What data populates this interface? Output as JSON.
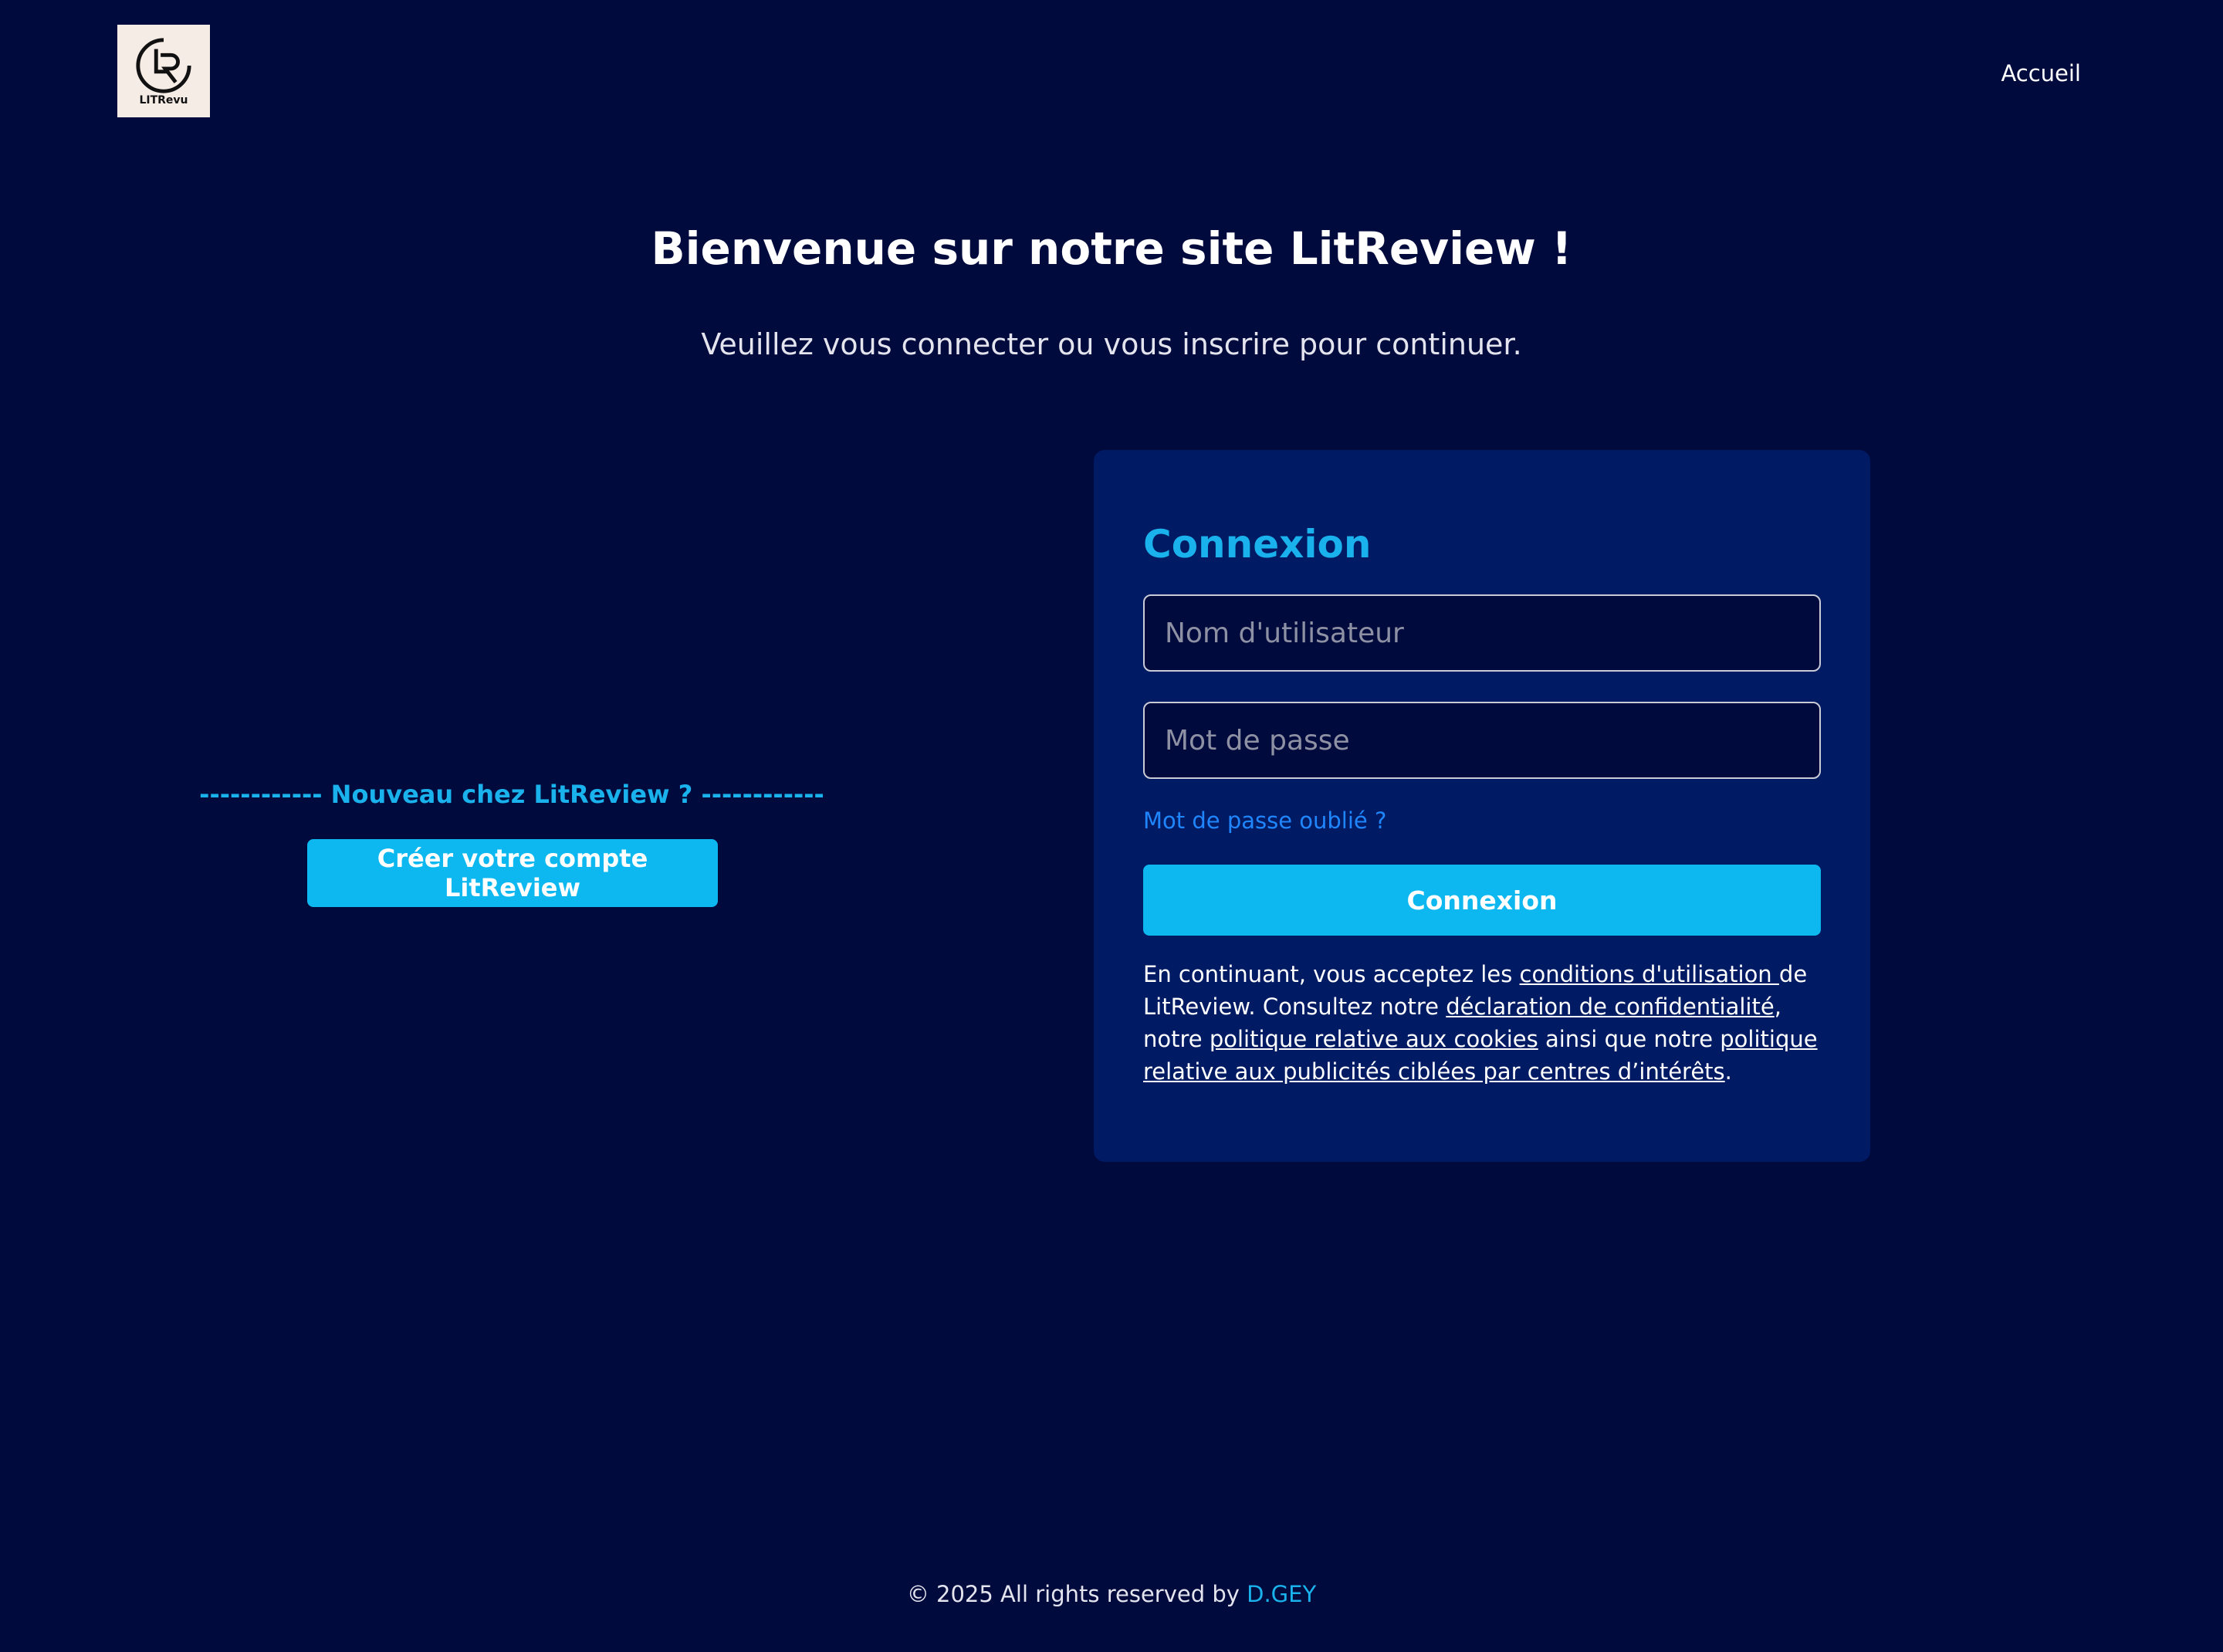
{
  "header": {
    "logo_text": "LITRevu",
    "nav_home": "Accueil"
  },
  "hero": {
    "title": "Bienvenue sur notre site LitReview !",
    "subtitle": "Veuillez vous connecter ou vous inscrire pour continuer."
  },
  "signup": {
    "heading": "------------ Nouveau chez LitReview ? ------------",
    "button_label": "Créer votre compte LitReview"
  },
  "login": {
    "title": "Connexion",
    "username_placeholder": "Nom d'utilisateur",
    "username_value": "",
    "password_placeholder": "Mot de passe",
    "password_value": "",
    "forgot_password": "Mot de passe oublié ?",
    "submit_label": "Connexion",
    "legal": {
      "part1": "En continuant, vous acceptez les ",
      "terms_link": "conditions d'utilisation ",
      "part2": "de LitReview. Consultez notre ",
      "privacy_link": "déclaration de confidentialité",
      "part3": ", notre ",
      "cookies_link": "politique relative aux cookies",
      "part4": " ainsi que notre ",
      "ads_link": "politique relative aux publicités ciblées par centres d’intérêts",
      "part5": "."
    }
  },
  "footer": {
    "copyright": "© 2025 All rights reserved by ",
    "author": "D.GEY"
  },
  "colors": {
    "background": "#010a3d",
    "card": "#001b63",
    "accent": "#0cb8ef",
    "link": "#1f86ff"
  },
  "icons": {
    "logo": "litrevu-logo-icon"
  }
}
